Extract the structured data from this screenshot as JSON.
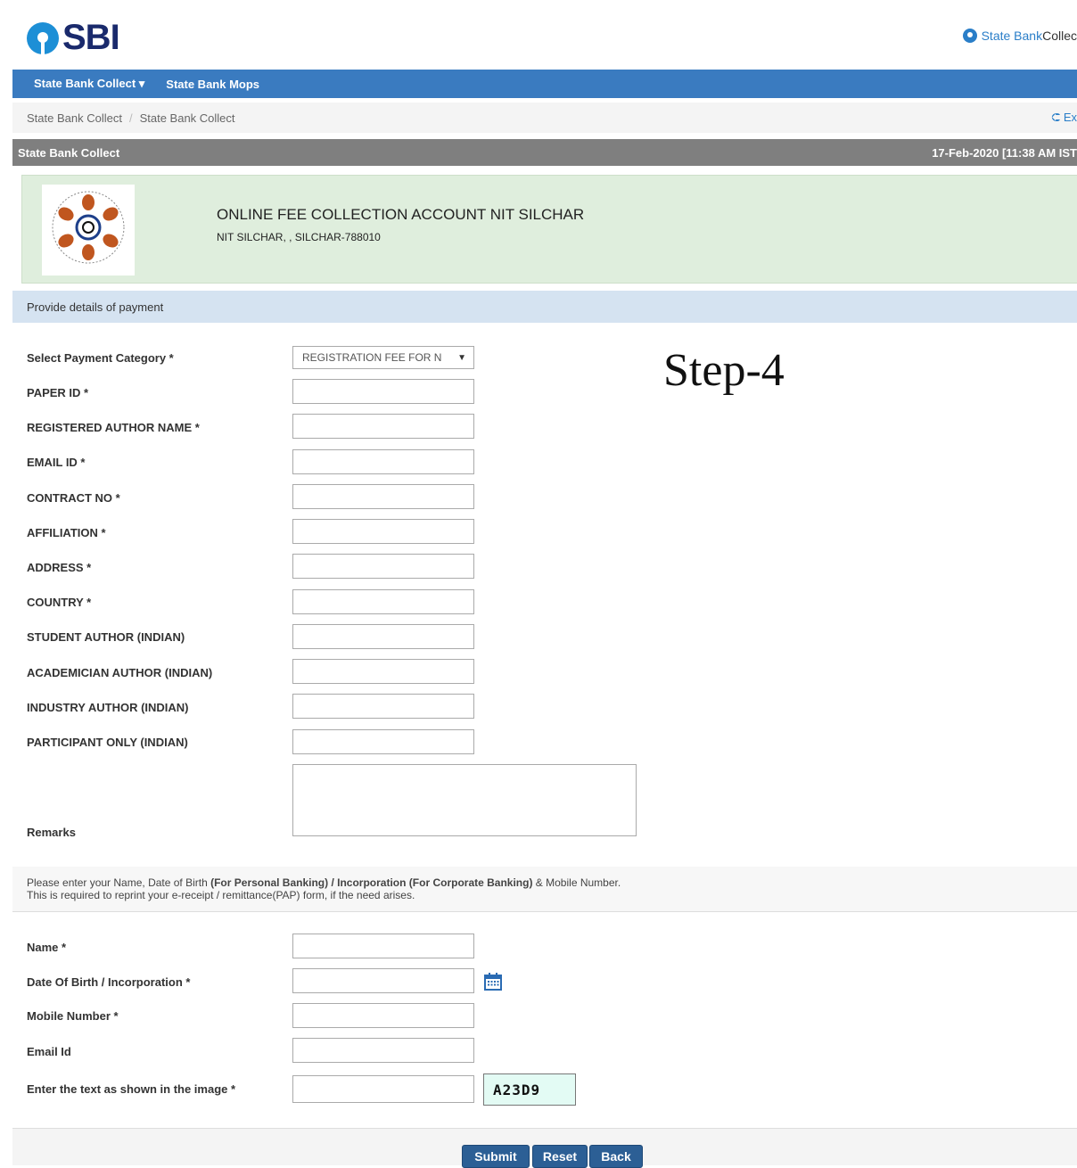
{
  "header": {
    "logo_text": "SBI",
    "brand_part1": "State Bank ",
    "brand_part2": "Collec"
  },
  "nav": {
    "items": [
      {
        "label": "State Bank Collect ▾"
      },
      {
        "label": "State Bank Mops"
      }
    ]
  },
  "breadcrumb": {
    "item1": "State Bank Collect",
    "separator": "/",
    "item2": "State Bank Collect",
    "exit_label": "⮈ Ex"
  },
  "section_bar": {
    "title": "State Bank Collect",
    "datetime": "17-Feb-2020 [11:38 AM IST"
  },
  "institution": {
    "title": "ONLINE FEE COLLECTION ACCOUNT NIT SILCHAR",
    "address": "NIT SILCHAR, , SILCHAR-788010"
  },
  "payment_section": {
    "heading": "Provide details of payment"
  },
  "annotation": "Step-4",
  "form": {
    "category_label": "Select Payment Category *",
    "category_value": "REGISTRATION FEE FOR N",
    "fields": [
      {
        "label": "PAPER ID *"
      },
      {
        "label": "REGISTERED AUTHOR NAME *"
      },
      {
        "label": "EMAIL ID *"
      },
      {
        "label": "CONTRACT NO *"
      },
      {
        "label": "AFFILIATION *"
      },
      {
        "label": "ADDRESS *"
      },
      {
        "label": "COUNTRY *"
      },
      {
        "label": "STUDENT AUTHOR (INDIAN)"
      },
      {
        "label": "ACADEMICIAN AUTHOR (INDIAN)"
      },
      {
        "label": "INDUSTRY AUTHOR (INDIAN)"
      },
      {
        "label": "PARTICIPANT ONLY (INDIAN)"
      }
    ],
    "remarks_label": "Remarks"
  },
  "note": {
    "line1_a": "Please enter your Name, Date of Birth ",
    "line1_b": "(For Personal Banking) / Incorporation (For Corporate Banking)",
    "line1_c": " & Mobile Number.",
    "line2": "This is required to reprint your e-receipt / remittance(PAP) form, if the need arises."
  },
  "personal": {
    "name_label": "Name *",
    "dob_label": "Date Of Birth / Incorporation *",
    "mobile_label": "Mobile Number *",
    "email_label": "Email Id",
    "captcha_label": "Enter the text as shown in the image *",
    "captcha_text": "A23D9"
  },
  "buttons": {
    "submit": "Submit",
    "reset": "Reset",
    "back": "Back"
  }
}
